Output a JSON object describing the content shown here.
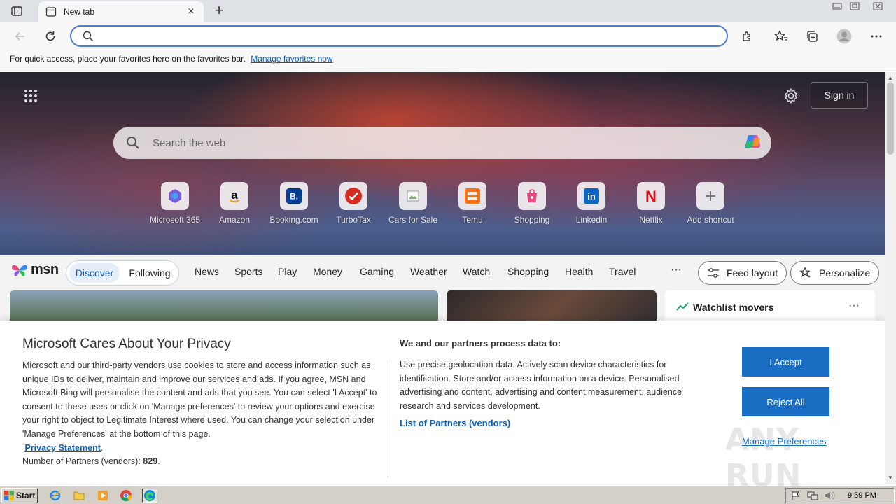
{
  "browser": {
    "tab_title": "New tab",
    "address_value": "",
    "favorites_bar_text": "For quick access, place your favorites here on the favorites bar.",
    "favorites_bar_link": "Manage favorites now"
  },
  "newtab": {
    "signin_label": "Sign in",
    "search_placeholder": "Search the web",
    "shortcuts": [
      {
        "label": "Microsoft 365",
        "icon": "microsoft-365-icon"
      },
      {
        "label": "Amazon",
        "icon": "amazon-icon"
      },
      {
        "label": "Booking.com",
        "icon": "booking-icon"
      },
      {
        "label": "TurboTax",
        "icon": "turbotax-icon"
      },
      {
        "label": "Cars for Sale",
        "icon": "cars-icon"
      },
      {
        "label": "Temu",
        "icon": "temu-icon"
      },
      {
        "label": "Shopping",
        "icon": "shopping-icon"
      },
      {
        "label": "Linkedin",
        "icon": "linkedin-icon"
      },
      {
        "label": "Netflix",
        "icon": "netflix-icon"
      },
      {
        "label": "Add shortcut",
        "icon": "plus-icon"
      }
    ]
  },
  "msn": {
    "logo": "msn",
    "feed_tabs": [
      "Discover",
      "Following"
    ],
    "nav": [
      "News",
      "Sports",
      "Play",
      "Money",
      "Gaming",
      "Weather",
      "Watch",
      "Shopping",
      "Health",
      "Travel"
    ],
    "more": "···",
    "feed_layout": "Feed layout",
    "personalize": "Personalize",
    "watchlist_title": "Watchlist movers",
    "watchlist_dots": "···"
  },
  "consent": {
    "title": "Microsoft Cares About Your Privacy",
    "body": "Microsoft and our third-party vendors use cookies to store and access information such as unique IDs to deliver, maintain and improve our services and ads. If you agree, MSN and Microsoft Bing will personalise the content and ads that you see. You can select 'I Accept' to consent to these uses or click on 'Manage preferences' to review your options and exercise your right to object to Legitimate Interest where used.  You can change your selection under 'Manage Preferences' at the bottom of this page.",
    "privacy_link": "Privacy Statement",
    "partners_count_label": "Number of Partners (vendors):",
    "partners_count": "829",
    "data_heading": "We and our partners process data to:",
    "data_body": "Use precise geolocation data. Actively scan device characteristics for identification. Store and/or access information on a device. Personalised advertising and content, advertising and content measurement, audience research and services development.",
    "partners_link": "List of Partners (vendors)",
    "accept": "I Accept",
    "reject": "Reject All",
    "manage": "Manage Preferences"
  },
  "watermark": "ANY RUN",
  "taskbar": {
    "start_label": "Start",
    "clock": "9:59 PM"
  },
  "colors": {
    "accent": "#1a6fc5",
    "link": "#0f5fb9",
    "address_border": "#4f7dd3"
  }
}
